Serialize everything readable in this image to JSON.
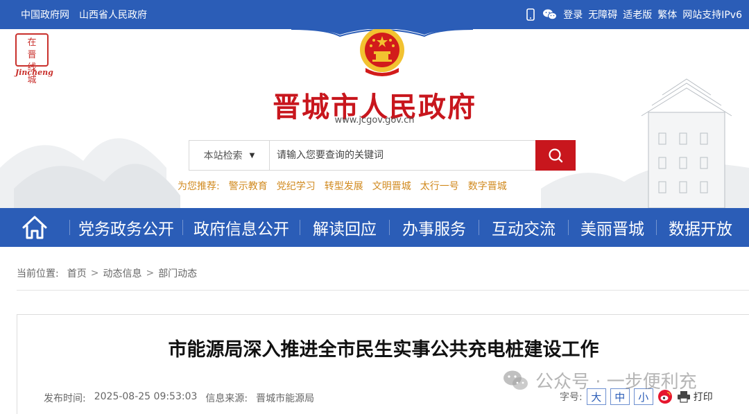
{
  "topbar": {
    "left_links": [
      "中国政府网",
      "山西省人民政府"
    ],
    "right_links": [
      "登录",
      "无障碍",
      "适老版",
      "繁体",
      "网站支持IPv6"
    ],
    "icons": [
      "mobile-icon",
      "wechat-icon"
    ]
  },
  "header": {
    "seal_chars": [
      "在",
      "晋",
      "线",
      "城"
    ],
    "seal_sub": "Jincheng",
    "site_title": "晋城市人民政府",
    "site_url": "www.jcgov.gov.cn"
  },
  "search": {
    "scope": "本站检索",
    "placeholder": "请输入您要查询的关键词",
    "button_icon": "search-icon"
  },
  "recommend": {
    "label": "为您推荐:",
    "links": [
      "警示教育",
      "党纪学习",
      "转型发展",
      "文明晋城",
      "太行一号",
      "数字晋城"
    ]
  },
  "nav": {
    "home_icon": "home-icon",
    "items": [
      "党务政务公开",
      "政府信息公开",
      "解读回应",
      "办事服务",
      "互动交流",
      "美丽晋城",
      "数据开放"
    ]
  },
  "breadcrumb": {
    "label": "当前位置:",
    "items": [
      "首页",
      "动态信息",
      "部门动态"
    ]
  },
  "article": {
    "title": "市能源局深入推进全市民生实事公共充电桩建设工作",
    "publish_label": "发布时间:",
    "publish_time": "2025-08-25 09:53:03",
    "source_label": "信息来源:",
    "source": "晋城市能源局",
    "fontsize_label": "字号:",
    "fontsize_options": [
      "大",
      "中",
      "小"
    ],
    "print_label": "打印"
  },
  "watermark": {
    "text": "公众号 · 一步便利充"
  },
  "colors": {
    "brand_blue": "#2b5db7",
    "brand_red": "#c8161d",
    "recommend": "#d18a1f"
  }
}
